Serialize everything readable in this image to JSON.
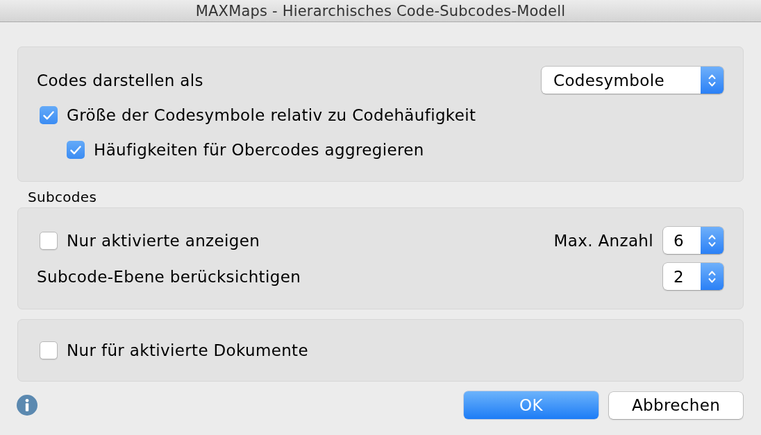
{
  "window": {
    "title": "MAXMaps - Hierarchisches Code-Subcodes-Modell"
  },
  "display": {
    "label": "Codes darstellen als",
    "dropdown": {
      "value": "Codesymbole"
    },
    "options": [
      {
        "label": "Größe der Codesymbole relativ zu Codehäufigkeit",
        "checked": true,
        "children": [
          {
            "label": "Häufigkeiten für Obercodes aggregieren",
            "checked": true
          }
        ]
      }
    ]
  },
  "subcodes": {
    "heading": "Subcodes",
    "only_activated": {
      "label": "Nur aktivierte anzeigen",
      "checked": false
    },
    "max_count": {
      "label": "Max. Anzahl",
      "value": "6"
    },
    "level": {
      "label": "Subcode-Ebene berücksichtigen",
      "value": "2"
    }
  },
  "documents": {
    "option": {
      "label": "Nur für aktivierte Dokumente",
      "checked": false
    }
  },
  "buttons": [
    {
      "label": "OK",
      "kind": "default"
    },
    {
      "label": "Abbrechen",
      "kind": "plain"
    }
  ]
}
